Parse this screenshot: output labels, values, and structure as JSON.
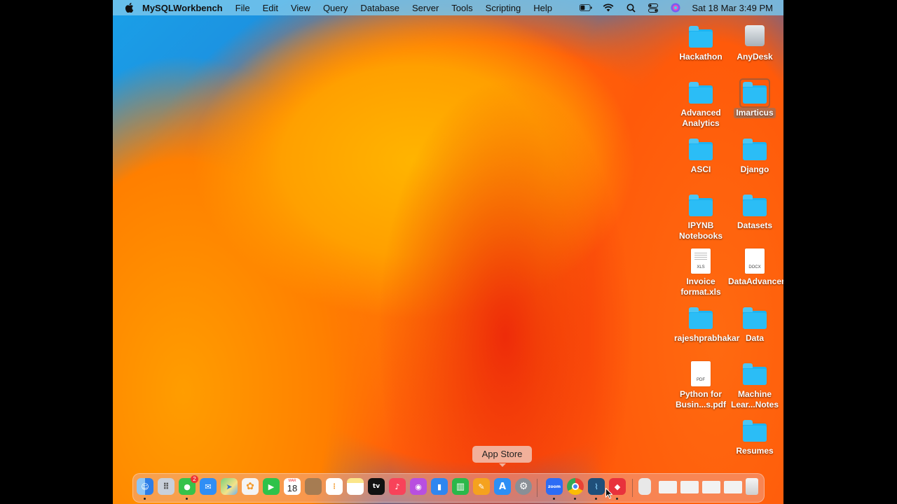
{
  "menubar": {
    "app_name": "MySQLWorkbench",
    "menus": [
      "File",
      "Edit",
      "View",
      "Query",
      "Database",
      "Server",
      "Tools",
      "Scripting",
      "Help"
    ],
    "clock": "Sat 18 Mar  3:49 PM"
  },
  "desktop_items": [
    {
      "label": "Hackathon",
      "kind": "folder"
    },
    {
      "label": "AnyDesk",
      "kind": "drive"
    },
    {
      "label": "Advanced Analytics",
      "kind": "folder"
    },
    {
      "label": "Imarticus",
      "kind": "folder",
      "selected": true
    },
    {
      "label": "ASCI",
      "kind": "folder"
    },
    {
      "label": "Django",
      "kind": "folder"
    },
    {
      "label": "IPYNB Notebooks",
      "kind": "folder"
    },
    {
      "label": "Datasets",
      "kind": "folder"
    },
    {
      "label": "Invoice format.xls",
      "kind": "doc",
      "ext": "XLS"
    },
    {
      "label": "DataAdvancerLabs",
      "kind": "doc",
      "ext": "DOCX"
    },
    {
      "label": "rajeshprabhakar",
      "kind": "folder"
    },
    {
      "label": "Data",
      "kind": "folder"
    },
    {
      "label": "Python for Busin...s.pdf",
      "kind": "doc",
      "ext": "PDF"
    },
    {
      "label": "Machine Lear...Notes",
      "kind": "folder"
    },
    {
      "label": "Resumes",
      "kind": "folder"
    }
  ],
  "tooltip": "App Store",
  "dock": {
    "calendar_day": "18",
    "calendar_month": "MAR",
    "messages_badge": "2",
    "appletv_label": "tv",
    "zoom_label": "zoom",
    "icons": [
      {
        "name": "finder-icon",
        "color": "#3d8ff0"
      },
      {
        "name": "launchpad-icon",
        "color": "#c9d0da"
      },
      {
        "name": "messages-icon",
        "color": "#36c24a"
      },
      {
        "name": "mail-icon",
        "color": "#2f8ef5"
      },
      {
        "name": "maps-icon",
        "color": "#58b858"
      },
      {
        "name": "photos-icon",
        "color": "#f4f4f4"
      },
      {
        "name": "facetime-icon",
        "color": "#2ec24a"
      },
      {
        "name": "calendar-icon",
        "color": "#ffffff"
      },
      {
        "name": "contacts-icon",
        "color": "#a67c52"
      },
      {
        "name": "reminders-icon",
        "color": "#ffffff"
      },
      {
        "name": "notes-icon",
        "color": "#fbe68a"
      },
      {
        "name": "appletv-icon",
        "color": "#111111"
      },
      {
        "name": "music-icon",
        "color": "#f8435a"
      },
      {
        "name": "podcasts-icon",
        "color": "#b84fe0"
      },
      {
        "name": "keynote-icon",
        "color": "#2e86f0"
      },
      {
        "name": "numbers-icon",
        "color": "#2bb84a"
      },
      {
        "name": "pages-icon",
        "color": "#f5a21e"
      },
      {
        "name": "appstore-icon",
        "color": "#2d8ff5"
      },
      {
        "name": "system-settings-icon",
        "color": "#8a8f96"
      },
      {
        "name": "zoom-icon",
        "color": "#2d6cf5"
      },
      {
        "name": "chrome-icon",
        "color": "#e94235"
      },
      {
        "name": "mysql-workbench-icon",
        "color": "#1f4f7a"
      },
      {
        "name": "anydesk-icon",
        "color": "#e8323c"
      },
      {
        "name": "preview-doc-icon",
        "color": "#e8e8e8"
      },
      {
        "name": "window-thumb-1-icon",
        "color": "#f2f2f2"
      },
      {
        "name": "window-thumb-2-icon",
        "color": "#f2f2f2"
      },
      {
        "name": "window-thumb-3-icon",
        "color": "#f2f2f2"
      },
      {
        "name": "window-thumb-4-icon",
        "color": "#f2f2f2"
      },
      {
        "name": "trash-icon",
        "color": "#e6e6e6"
      }
    ]
  }
}
